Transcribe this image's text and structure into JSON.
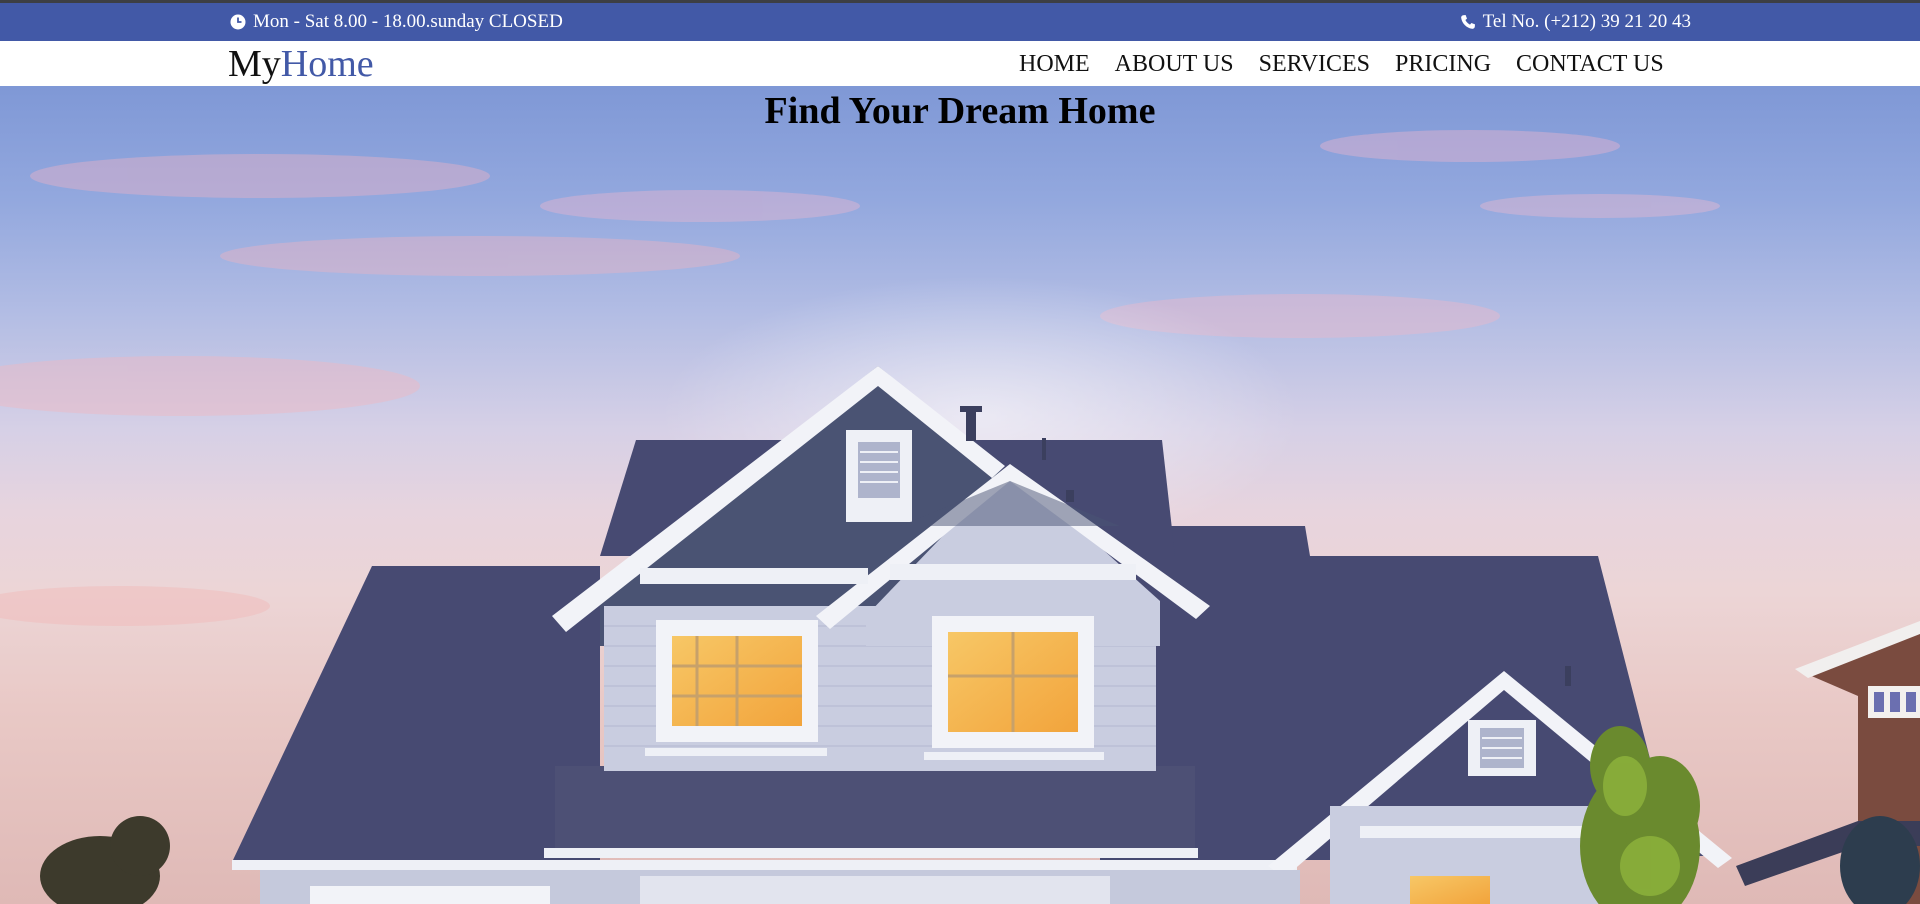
{
  "topbar": {
    "hours_icon": "clock-icon",
    "hours_text": "Mon - Sat 8.00 - 18.00.sunday CLOSED",
    "phone_icon": "phone-icon",
    "phone_text": "Tel No. (+212) 39 21 20 43"
  },
  "logo": {
    "part1": "My",
    "part2": "Home"
  },
  "nav": {
    "items": [
      {
        "label": "HOME"
      },
      {
        "label": "ABOUT US"
      },
      {
        "label": "SERVICES"
      },
      {
        "label": "PRICING"
      },
      {
        "label": "CONTACT US"
      }
    ]
  },
  "hero": {
    "title": "Find Your Dream Home",
    "image": "house-at-dusk-image"
  },
  "colors": {
    "brand": "#4259a7",
    "topbar_bg": "#4259a7",
    "nav_bg": "#ffffff",
    "text": "#111111"
  }
}
